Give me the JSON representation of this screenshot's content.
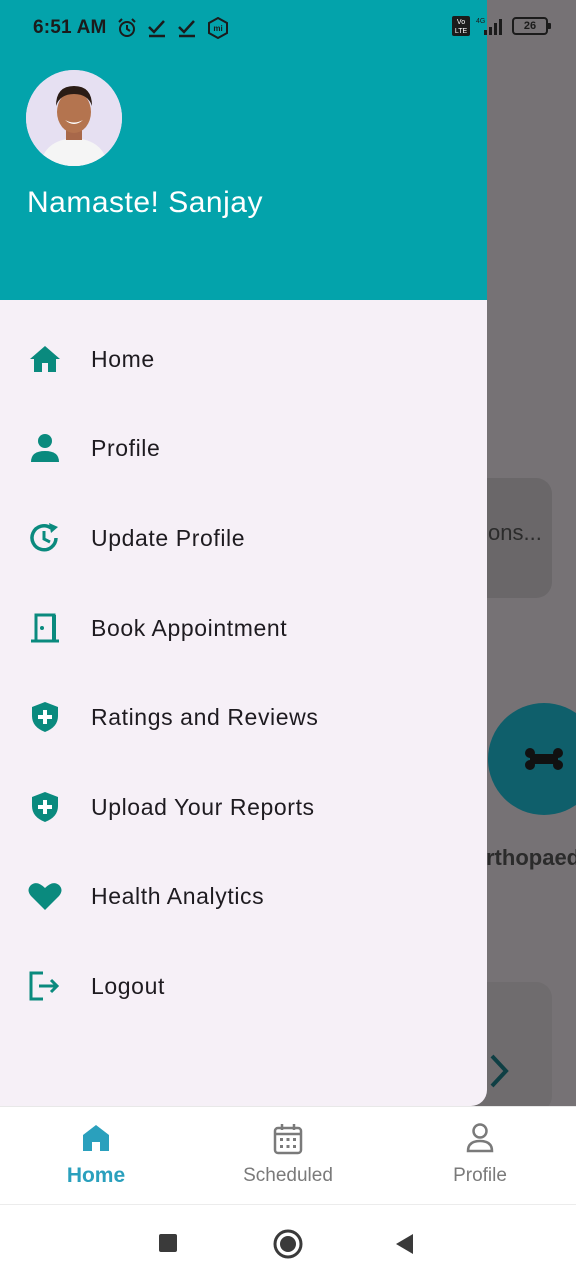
{
  "status_bar": {
    "time": "6:51 AM",
    "left_icons": [
      "alarm-icon",
      "check-icon",
      "check-icon",
      "mi-icon"
    ],
    "network": "VoLTE 4G",
    "battery": "26"
  },
  "drawer": {
    "greeting": "Namaste! Sanjay",
    "header_color": "#03a3ab",
    "accent_color": "#0a8a7e",
    "items": [
      {
        "label": "Home",
        "icon": "home-icon"
      },
      {
        "label": "Profile",
        "icon": "person-icon"
      },
      {
        "label": "Update Profile",
        "icon": "update-clock-icon"
      },
      {
        "label": "Book Appointment",
        "icon": "door-icon"
      },
      {
        "label": "Ratings and Reviews",
        "icon": "shield-plus-icon"
      },
      {
        "label": "Upload Your Reports",
        "icon": "shield-plus-icon"
      },
      {
        "label": "Health Analytics",
        "icon": "heart-icon"
      },
      {
        "label": "Logout",
        "icon": "logout-icon"
      }
    ]
  },
  "background": {
    "card_text": "ons...",
    "category_label": "rthopaedi"
  },
  "bottom_nav": {
    "active_color": "#2aa0bd",
    "items": [
      {
        "label": "Home",
        "icon": "home-icon",
        "active": true
      },
      {
        "label": "Scheduled",
        "icon": "calendar-icon",
        "active": false
      },
      {
        "label": "Profile",
        "icon": "person-outline-icon",
        "active": false
      }
    ]
  },
  "system_nav": {
    "buttons": [
      "recents-icon",
      "home-circle-icon",
      "back-icon"
    ]
  }
}
